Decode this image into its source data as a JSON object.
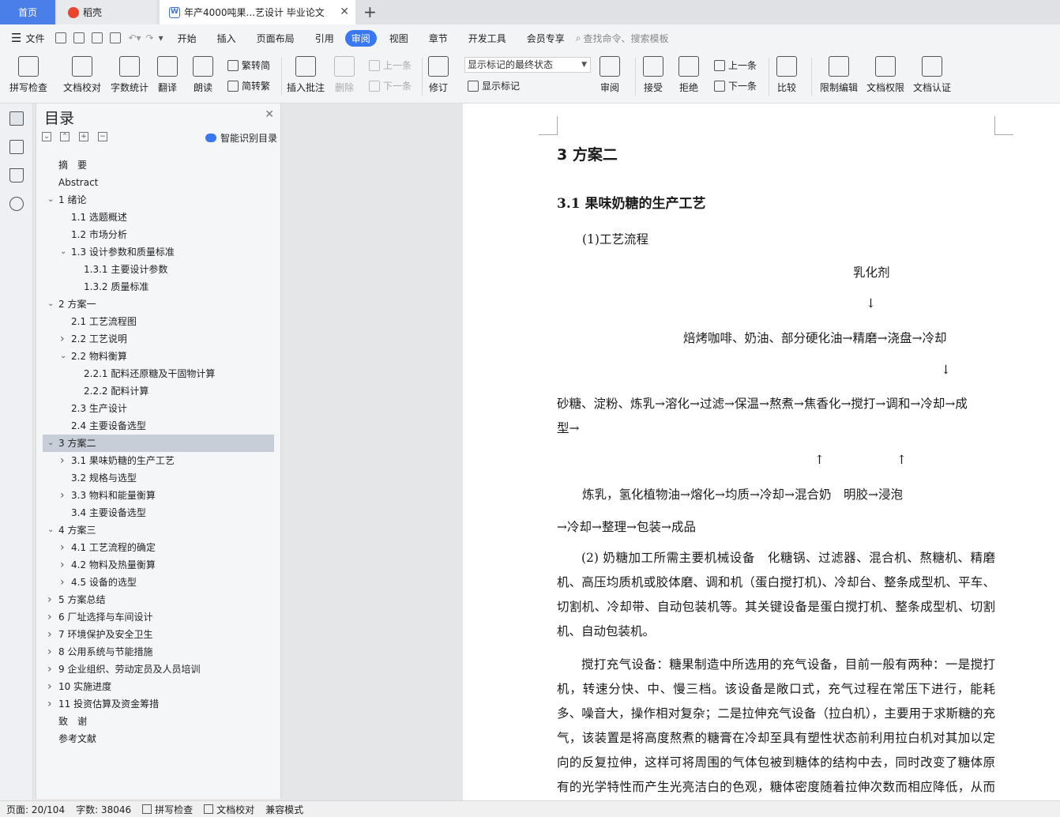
{
  "tabs": {
    "home": "首页",
    "daoke": "稻壳",
    "doc": "年产4000吨果...艺设计 毕业论文"
  },
  "menu": {
    "file": "文件",
    "items": [
      "开始",
      "插入",
      "页面布局",
      "引用",
      "审阅",
      "视图",
      "章节",
      "开发工具",
      "会员专享"
    ],
    "active": "审阅",
    "search": "查找命令、搜索模板"
  },
  "toolbar": {
    "spell": "拼写检查",
    "proof": "文档校对",
    "wordcount": "字数统计",
    "translate": "翻译",
    "read": "朗读",
    "trad_to_simp": "繁转简",
    "simp_to_trad": "简转繁",
    "insert_comment": "插入批注",
    "delete": "删除",
    "prev": "上一条",
    "next": "下一条",
    "track": "修订",
    "markup_state": "显示标记的最终状态",
    "show_markup": "显示标记",
    "review": "审阅",
    "accept": "接受",
    "reject": "拒绝",
    "prev2": "上一条",
    "next2": "下一条",
    "compare": "比较",
    "restrict_edit": "限制编辑",
    "doc_perm": "文档权限",
    "doc_cert": "文档认证"
  },
  "toc": {
    "title": "目录",
    "smart": "智能识别目录",
    "items": [
      {
        "label": "摘　要"
      },
      {
        "label": "Abstract"
      },
      {
        "label": "1 绪论"
      },
      {
        "label": "1.1 选题概述"
      },
      {
        "label": "1.2 市场分析"
      },
      {
        "label": "1.3 设计参数和质量标准"
      },
      {
        "label": "1.3.1 主要设计参数"
      },
      {
        "label": "1.3.2 质量标准"
      },
      {
        "label": "2 方案一"
      },
      {
        "label": "2.1 工艺流程图"
      },
      {
        "label": "2.2 工艺说明"
      },
      {
        "label": "2.2 物料衡算"
      },
      {
        "label": "2.2.1 配料还原糖及干固物计算"
      },
      {
        "label": "2.2.2 配料计算"
      },
      {
        "label": "2.3 生产设计"
      },
      {
        "label": "2.4 主要设备选型"
      },
      {
        "label": "3 方案二"
      },
      {
        "label": "3.1 果味奶糖的生产工艺"
      },
      {
        "label": "3.2 规格与选型"
      },
      {
        "label": "3.3 物料和能量衡算"
      },
      {
        "label": "3.4 主要设备选型"
      },
      {
        "label": "4 方案三"
      },
      {
        "label": "4.1 工艺流程的确定"
      },
      {
        "label": "4.2 物料及热量衡算"
      },
      {
        "label": "4.5 设备的选型"
      },
      {
        "label": "5 方案总结"
      },
      {
        "label": "6 厂址选择与车间设计"
      },
      {
        "label": "7 环境保护及安全卫生"
      },
      {
        "label": "8 公用系统与节能措施"
      },
      {
        "label": "9 企业组织、劳动定员及人员培训"
      },
      {
        "label": "10 实施进度"
      },
      {
        "label": "11 投资估算及资金筹措"
      },
      {
        "label": "致　谢"
      },
      {
        "label": "参考文献"
      }
    ]
  },
  "doc": {
    "h1": "3 方案二",
    "h2": "3.1 果味奶糖的生产工艺",
    "flow_title": "(1)工艺流程",
    "emulsifier": "乳化剂",
    "arrow_down": "↓",
    "arrow_up": "↑",
    "line1": "焙烤咖啡、奶油、部分硬化油→精磨→浇盘→冷却",
    "line2a": "砂糖、淀粉、炼乳→溶化→过滤→保温→熬煮→焦香化→搅打→调和→冷却→成",
    "line2b": "型→",
    "line3": "炼乳，氢化植物油→熔化→均质→冷却→混合奶　明胶→浸泡",
    "line4": "→冷却→整理→包装→成品",
    "para2": "(2) 奶糖加工所需主要机械设备　化糖锅、过滤器、混合机、熬糖机、精磨机、高压均质机或胶体磨、调和机（蛋白搅打机)、冷却台、整条成型机、平车、切割机、冷却带、自动包装机等。其关键设备是蛋白搅打机、整条成型机、切割机、自动包装机。",
    "para3": "搅打充气设备：糖果制造中所选用的充气设备，目前一般有两种：一是搅打机，转速分快、中、慢三档。该设备是敞口式，充气过程在常压下进行，能耗多、噪音大，操作相对复杂；二是拉伸充气设备（拉白机），主要用于求斯糖的充气，该装置是将高度熬煮的糖膏在冷却至具有塑性状态前利用拉白机对其加以定向的反复拉伸，这样可将周围的气体包被到糖体的结构中去，同时改变了糖体原有的光学特性而产生光亮洁白的色观，糖体密度随着拉伸次数而相应降低，从而变"
  },
  "status": {
    "page": "页面: 20/104",
    "words": "字数: 38046",
    "spell": "拼写检查",
    "proof": "文档校对",
    "compat": "兼容模式"
  }
}
